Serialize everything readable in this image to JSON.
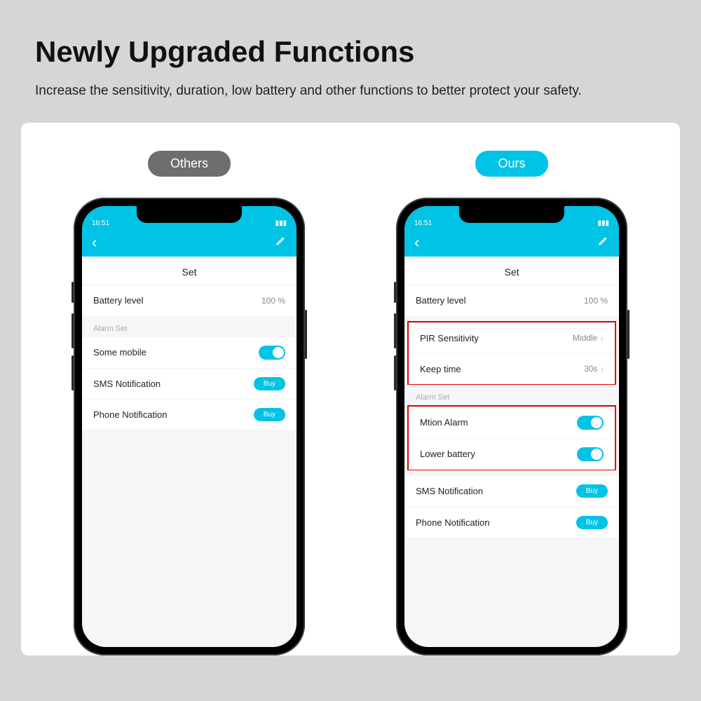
{
  "header": {
    "title": "Newly Upgraded Functions",
    "subtitle": "Increase the sensitivity, duration, low battery and other functions to better protect your safety."
  },
  "columns": {
    "others": {
      "badge": "Others",
      "status_time": "16:51",
      "screen_title": "Set",
      "battery_label": "Battery level",
      "battery_value": "100 %",
      "alarm_set_label": "Alarm Set",
      "some_mobile": "Some mobile",
      "sms_label": "SMS Notification",
      "phone_label": "Phone Notification",
      "buy_label": "Buy"
    },
    "ours": {
      "badge": "Ours",
      "status_time": "16:51",
      "screen_title": "Set",
      "battery_label": "Battery level",
      "battery_value": "100 %",
      "pir_label": "PIR Sensitivity",
      "pir_value": "Middle",
      "keep_label": "Keep time",
      "keep_value": "30s",
      "alarm_set_label": "Alarm Set",
      "motion_label": "Mtion Alarm",
      "lowbatt_label": "Lower battery",
      "sms_label": "SMS Notification",
      "phone_label": "Phone Notification",
      "buy_label": "Buy"
    }
  }
}
